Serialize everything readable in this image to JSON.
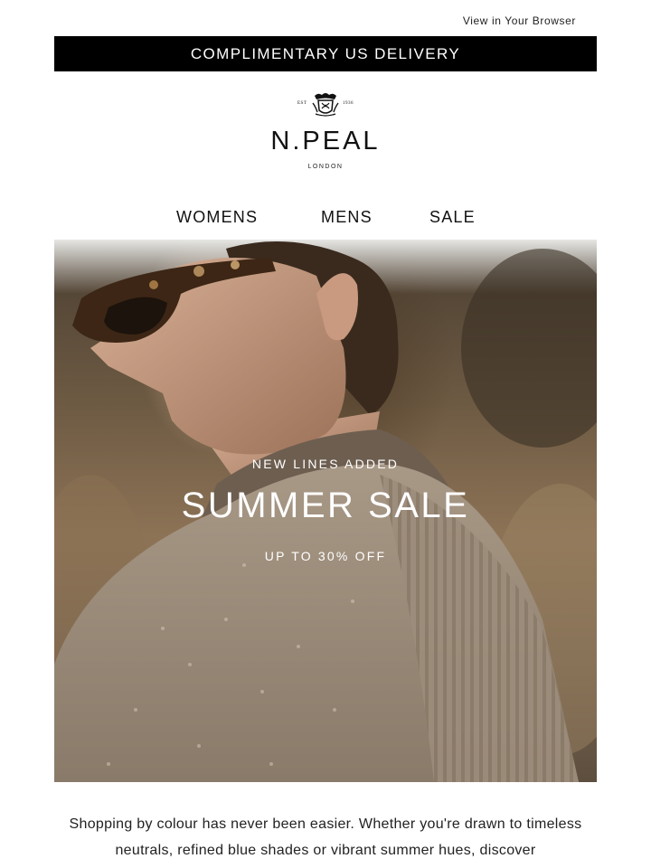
{
  "header": {
    "view_in_browser": "View in Your Browser",
    "promo": "COMPLIMENTARY US DELIVERY"
  },
  "brand": {
    "est": "EST",
    "year": "1936",
    "name": "N.PEAL",
    "location": "LONDON"
  },
  "nav": {
    "items": [
      {
        "label": "WOMENS"
      },
      {
        "label": "MENS"
      },
      {
        "label": "SALE"
      }
    ]
  },
  "hero": {
    "eyebrow": "NEW LINES ADDED",
    "headline": "SUMMER SALE",
    "subline": "UP TO 30% OFF"
  },
  "body": {
    "text": "Shopping by colour has never been easier. Whether you're drawn to timeless neutrals, refined blue shades or vibrant summer hues, discover"
  },
  "colors": {
    "promo_bg": "#000000",
    "text": "#111111"
  }
}
